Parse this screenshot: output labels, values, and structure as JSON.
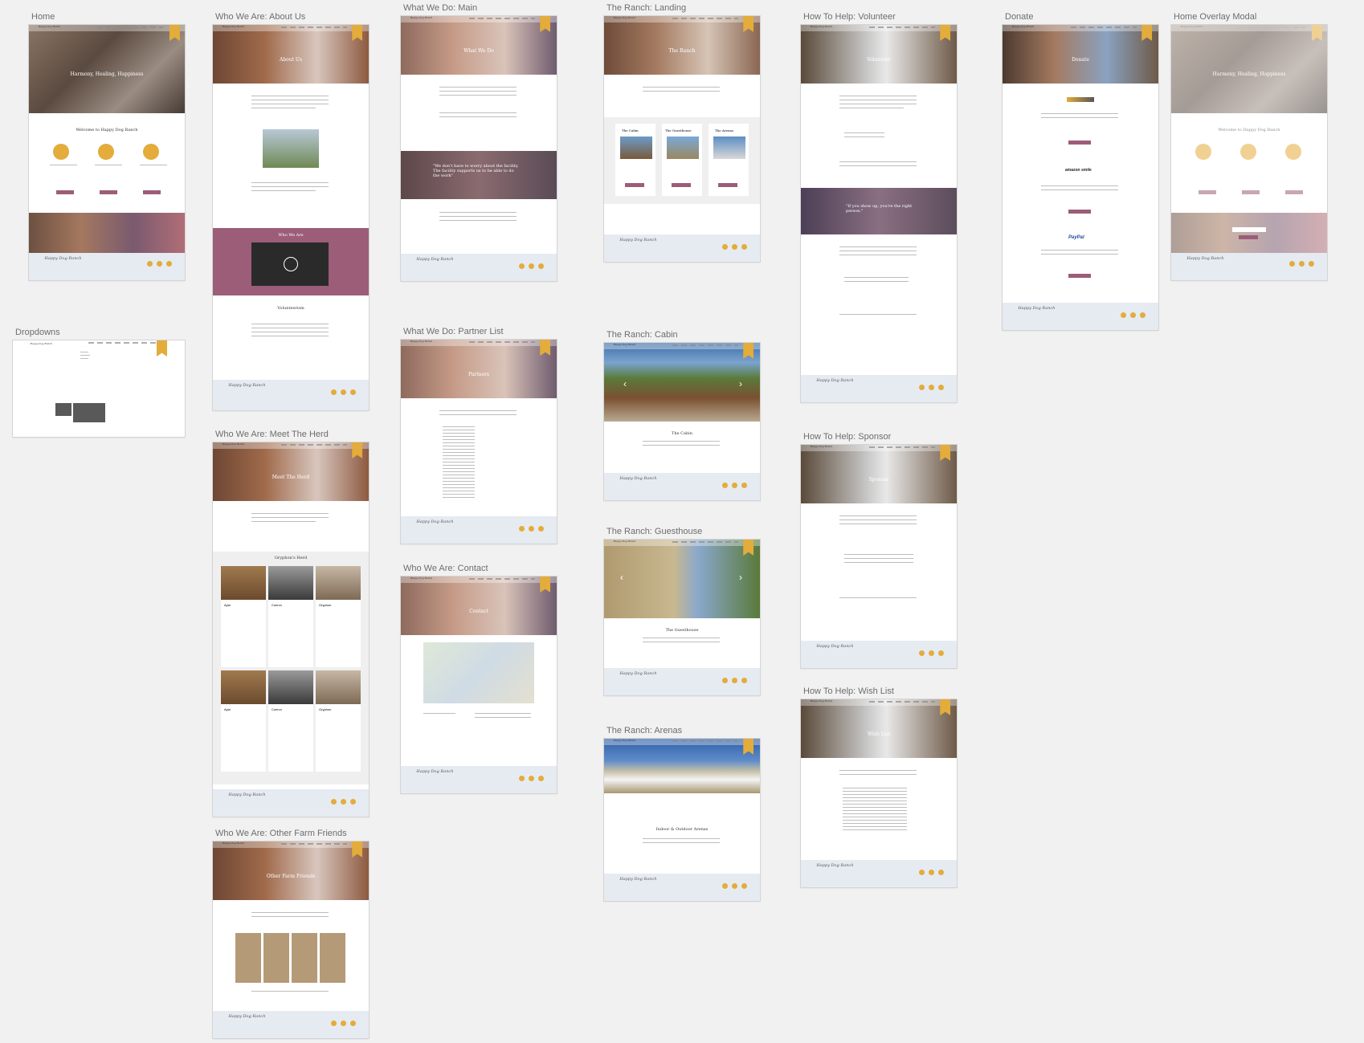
{
  "boards": {
    "home": "Home",
    "dropdowns": "Dropdowns",
    "about_us": "Who We Are: About Us",
    "meet_herd": "Who We Are: Meet The Herd",
    "other_friends": "Who We Are: Other Farm Friends",
    "what_main": "What We Do: Main",
    "partner_list": "What We Do: Partner List",
    "contact": "Who We Are: Contact",
    "ranch_landing": "The Ranch: Landing",
    "ranch_cabin": "The Ranch: Cabin",
    "ranch_guesthouse": "The Ranch: Guesthouse",
    "ranch_arenas": "The Ranch: Arenas",
    "volunteer": "How To Help: Volunteer",
    "sponsor": "How To Help: Sponsor",
    "wish_list": "How To Help: Wish List",
    "donate": "Donate",
    "overlay_modal": "Home Overlay Modal"
  },
  "site": {
    "logo": "Happy Dog Ranch",
    "hero_home": "Harmony, Healing, Happiness",
    "welcome": "Welcome to Happy Dog Ranch",
    "hero_about": "About Us",
    "hero_what": "What We Do",
    "hero_herd": "Meet The Herd",
    "hero_friends": "Other Farm Friends",
    "hero_partners": "Partners",
    "hero_contact": "Contact",
    "hero_ranch": "The Ranch",
    "hero_volunteer": "Volunteer",
    "hero_donate": "Donate",
    "hero_sponsor": "Sponsor",
    "hero_wish": "Wish List",
    "who_we_are": "Who We Are",
    "volunteerism": "Volunteerism",
    "gryphons_herd": "Gryphon's Herd",
    "cabin_title": "The Cabin",
    "guesthouse_title": "The Guesthouse",
    "arenas_title": "Indoor & Outdoor Arenas",
    "quote_what": "\"We don't have to worry about the facility. The facility supports us to be able to do the work\"",
    "quote_volunteer": "\"If you show up, you're the right person.\"",
    "card_cabin": "The Cabin",
    "card_guesthouse": "The Guesthouse",
    "card_arenas": "The Arenas",
    "horse_names": [
      "Ayla",
      "Cuervo",
      "Gryphon",
      "Ayla",
      "Cuervo",
      "Gryphon"
    ],
    "amazon": "amazon smile",
    "paypal": "PayPal",
    "button_about": "About Us",
    "button_donate": "Donate",
    "button_ranch": "The Ranch",
    "button_more": "Learn More"
  },
  "colors": {
    "gold": "#e3ac3b",
    "mauve": "#9c5d79",
    "footer": "#e6ebf2"
  }
}
